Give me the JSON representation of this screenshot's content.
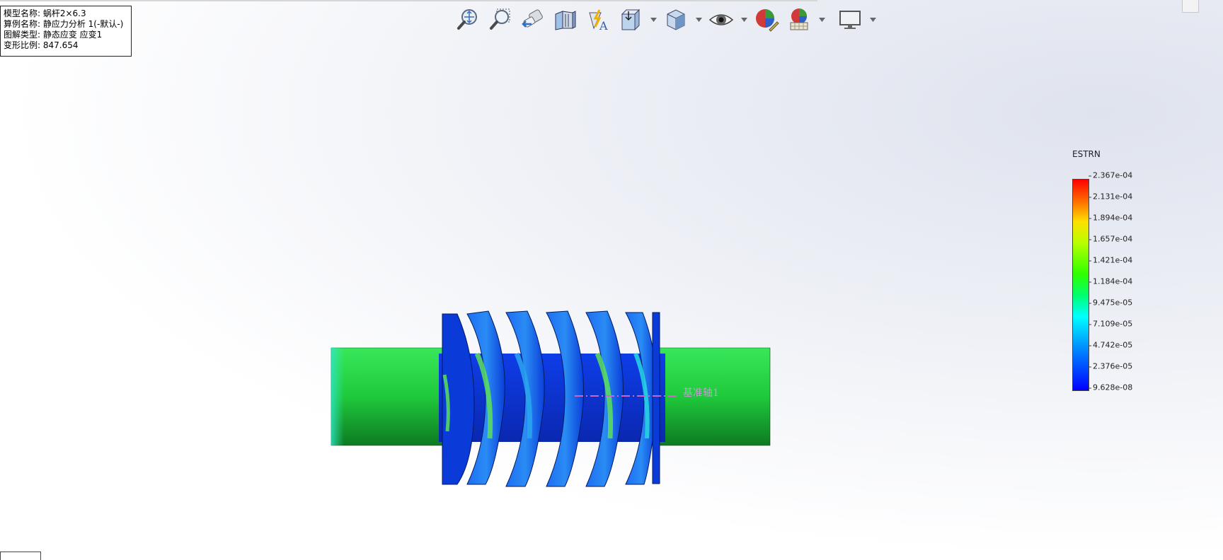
{
  "info_box": {
    "model_name": "模型名称: 蜗杆2×6.3",
    "study_name": "算例名称: 静应力分析 1(-默认-)",
    "plot_type": "图解类型: 静态应变 应变1",
    "deformation_scale": "变形比例: 847.654"
  },
  "toolbar": {
    "buttons": [
      {
        "icon": "zoom-to-fit-icon"
      },
      {
        "icon": "zoom-to-area-icon"
      },
      {
        "icon": "previous-view-icon"
      },
      {
        "icon": "section-view-icon"
      },
      {
        "icon": "dynamic-annotation-views-icon"
      },
      {
        "icon": "view-orientation-icon",
        "dropdown": true
      },
      {
        "icon": "display-style-icon",
        "dropdown": true
      },
      {
        "icon": "hide-show-items-icon",
        "dropdown": true
      },
      {
        "icon": "edit-appearance-icon"
      },
      {
        "icon": "apply-scene-icon",
        "dropdown": true
      },
      {
        "icon": "view-settings-icon",
        "dropdown": true
      }
    ]
  },
  "legend": {
    "title": "ESTRN",
    "labels": [
      "2.367e-04",
      "2.131e-04",
      "1.894e-04",
      "1.657e-04",
      "1.421e-04",
      "1.184e-04",
      "9.475e-05",
      "7.109e-05",
      "4.742e-05",
      "2.376e-05",
      "9.628e-08"
    ],
    "colors": {
      "max": "#ff0000",
      "mid": "#00ff00",
      "min": "#0000ff"
    }
  },
  "model": {
    "datum_axis_label": "基准轴1",
    "colors": {
      "shaft": "#22d640",
      "thread": "#0a3df0",
      "datum_axis": "#cc66cc"
    }
  }
}
